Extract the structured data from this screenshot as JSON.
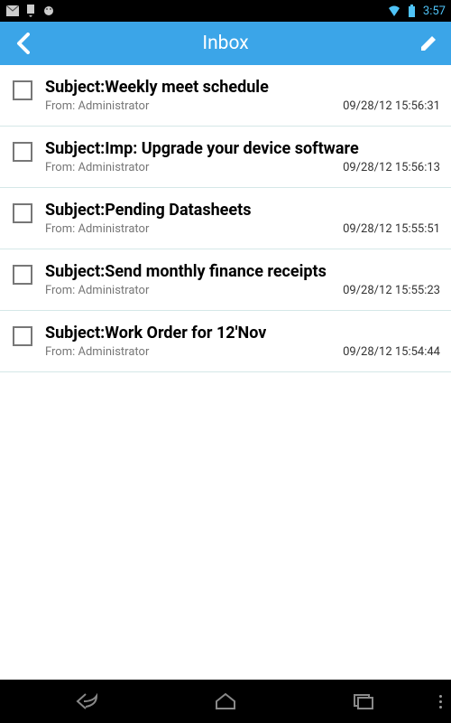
{
  "status": {
    "time": "3:57"
  },
  "header": {
    "title": "Inbox"
  },
  "messages": [
    {
      "subject_label": "Subject: ",
      "subject": "Weekly meet schedule",
      "from_label": "From: ",
      "from": "Administrator",
      "timestamp": "09/28/12 15:56:31"
    },
    {
      "subject_label": "Subject: ",
      "subject": "Imp: Upgrade your device software",
      "from_label": "From: ",
      "from": "Administrator",
      "timestamp": "09/28/12 15:56:13"
    },
    {
      "subject_label": "Subject: ",
      "subject": "Pending Datasheets",
      "from_label": "From: ",
      "from": "Administrator",
      "timestamp": "09/28/12 15:55:51"
    },
    {
      "subject_label": "Subject: ",
      "subject": "Send monthly finance receipts",
      "from_label": "From: ",
      "from": "Administrator",
      "timestamp": "09/28/12 15:55:23"
    },
    {
      "subject_label": "Subject: ",
      "subject": "Work Order for 12'Nov",
      "from_label": "From: ",
      "from": "Administrator",
      "timestamp": "09/28/12 15:54:44"
    }
  ]
}
